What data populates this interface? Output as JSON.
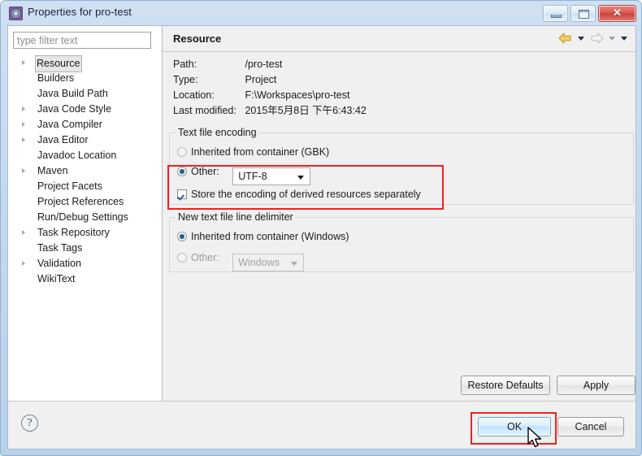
{
  "window": {
    "title": "Properties for pro-test",
    "icon": "gear-icon",
    "buttons": {
      "minimize": "minimize-icon",
      "maximize": "maximize-icon",
      "close": "✕"
    }
  },
  "sidebar": {
    "filter": {
      "placeholder": "type filter text",
      "value": ""
    },
    "items": [
      {
        "label": "Resource",
        "expandable": true,
        "selected": true
      },
      {
        "label": "Builders",
        "expandable": false,
        "selected": false
      },
      {
        "label": "Java Build Path",
        "expandable": false,
        "selected": false
      },
      {
        "label": "Java Code Style",
        "expandable": true,
        "selected": false
      },
      {
        "label": "Java Compiler",
        "expandable": true,
        "selected": false
      },
      {
        "label": "Java Editor",
        "expandable": true,
        "selected": false
      },
      {
        "label": "Javadoc Location",
        "expandable": false,
        "selected": false
      },
      {
        "label": "Maven",
        "expandable": true,
        "selected": false
      },
      {
        "label": "Project Facets",
        "expandable": false,
        "selected": false
      },
      {
        "label": "Project References",
        "expandable": false,
        "selected": false
      },
      {
        "label": "Run/Debug Settings",
        "expandable": false,
        "selected": false
      },
      {
        "label": "Task Repository",
        "expandable": true,
        "selected": false
      },
      {
        "label": "Task Tags",
        "expandable": false,
        "selected": false
      },
      {
        "label": "Validation",
        "expandable": true,
        "selected": false
      },
      {
        "label": "WikiText",
        "expandable": false,
        "selected": false
      }
    ]
  },
  "page": {
    "title": "Resource",
    "nav": {
      "back": "back-arrow-icon",
      "back_menu": "chevron-down-icon",
      "forward": "forward-arrow-icon",
      "forward_menu": "chevron-down-icon",
      "view_menu": "chevron-down-icon"
    },
    "info": [
      {
        "key": "Path:",
        "value": "/pro-test"
      },
      {
        "key": "Type:",
        "value": "Project"
      },
      {
        "key": "Location:",
        "value": "F:\\Workspaces\\pro-test"
      },
      {
        "key": "Last modified:",
        "value": "2015年5月8日 下午6:43:42"
      }
    ],
    "encoding_group": {
      "legend": "Text file encoding",
      "inherited_label": "Inherited from container (GBK)",
      "inherited_selected": false,
      "other_label": "Other:",
      "other_selected": true,
      "other_value": "UTF-8",
      "store_label": "Store the encoding of derived resources separately",
      "store_checked": true
    },
    "delimiter_group": {
      "legend": "New text file line delimiter",
      "inherited_label": "Inherited from container (Windows)",
      "inherited_selected": true,
      "other_label": "Other:",
      "other_selected": false,
      "other_value": "Windows",
      "other_disabled": true
    },
    "restore_defaults_label": "Restore Defaults",
    "apply_label": "Apply"
  },
  "footer": {
    "help": "?",
    "ok_label": "OK",
    "cancel_label": "Cancel"
  },
  "annotations": {
    "highlight_color": "#f41f1f"
  }
}
